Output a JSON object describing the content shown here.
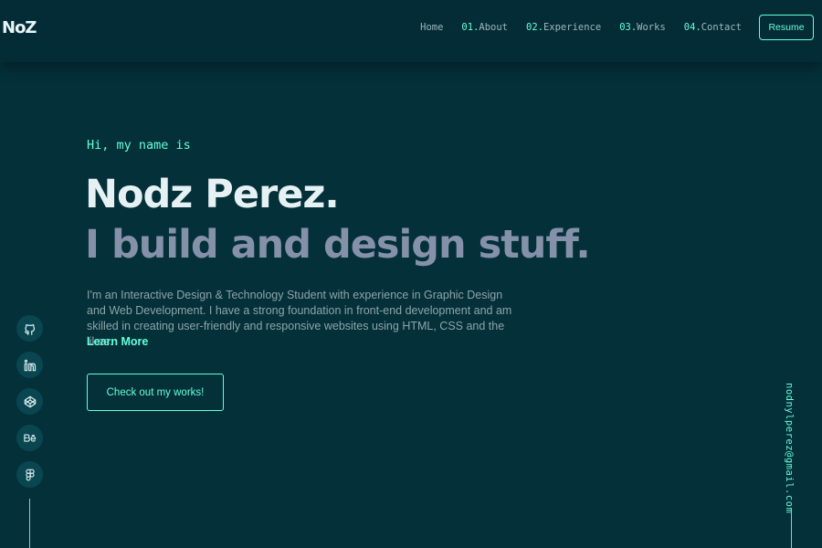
{
  "nav": {
    "logo": "NoZ",
    "links": [
      {
        "num": "",
        "label": "Home"
      },
      {
        "num": "01.",
        "label": "About"
      },
      {
        "num": "02.",
        "label": "Experience"
      },
      {
        "num": "03.",
        "label": "Works"
      },
      {
        "num": "04.",
        "label": "Contact"
      }
    ],
    "resume_label": "Resume"
  },
  "hero": {
    "greeting": "Hi, my name is",
    "name": "Nodz Perez.",
    "tagline": "I build and design stuff.",
    "bio": "I'm an Interactive Design & Technology Student with experience in Graphic Design and Web Development. I have a strong foundation in front-end development and am skilled in creating user-friendly and responsive websites using HTML, CSS and the likes.",
    "learn_more": "Learn More",
    "cta_label": "Check out my works!"
  },
  "social": [
    {
      "icon": "github-icon"
    },
    {
      "icon": "linkedin-icon"
    },
    {
      "icon": "codepen-icon"
    },
    {
      "icon": "behance-icon"
    },
    {
      "icon": "figma-icon"
    }
  ],
  "email": "nodnylperez@gmail.com",
  "colors": {
    "background": "#04303a",
    "nav_background": "#042c36",
    "accent": "#64ffda",
    "heading": "#e6f1f3",
    "subheading": "#8591a8",
    "body_text": "#8fa4aa"
  }
}
